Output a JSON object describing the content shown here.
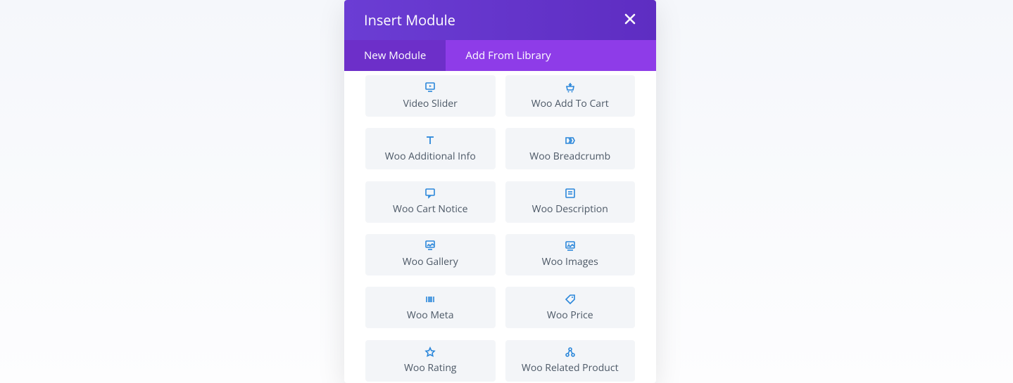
{
  "modal": {
    "title": "Insert Module",
    "tabs": {
      "new_module": "New Module",
      "add_from_library": "Add From Library"
    },
    "modules": {
      "video_slider": "Video Slider",
      "woo_add_to_cart": "Woo Add To Cart",
      "woo_additional_info": "Woo Additional Info",
      "woo_breadcrumb": "Woo Breadcrumb",
      "woo_cart_notice": "Woo Cart Notice",
      "woo_description": "Woo Description",
      "woo_gallery": "Woo Gallery",
      "woo_images": "Woo Images",
      "woo_meta": "Woo Meta",
      "woo_price": "Woo Price",
      "woo_rating": "Woo Rating",
      "woo_related_product": "Woo Related Product"
    }
  }
}
